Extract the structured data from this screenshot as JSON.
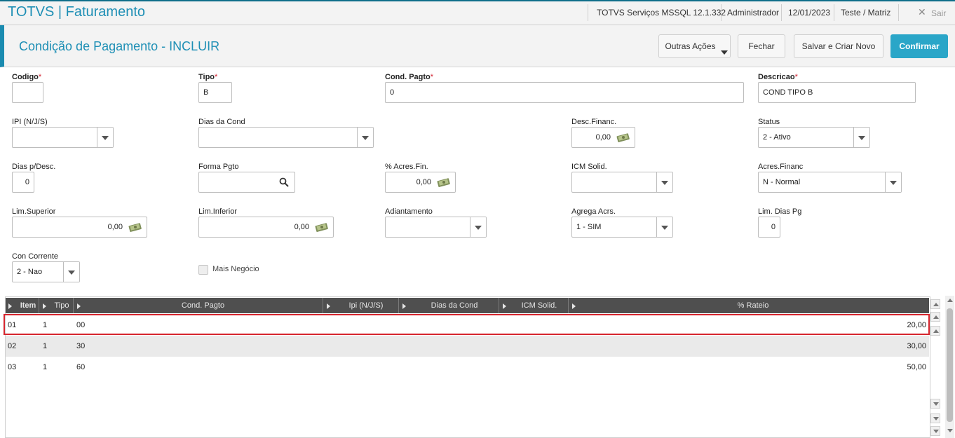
{
  "app": {
    "title": "TOTVS | Faturamento"
  },
  "topbar": {
    "server": "TOTVS Serviços MSSQL 12.1.332",
    "user": "Administrador",
    "date": "12/01/2023",
    "branch": "Teste / Matriz",
    "exit_label": "Sair"
  },
  "header": {
    "title": "Condição de Pagamento - INCLUIR",
    "buttons": {
      "outras_acoes": "Outras Ações",
      "fechar": "Fechar",
      "salvar_novo": "Salvar e Criar Novo",
      "confirmar": "Confirmar"
    }
  },
  "form": {
    "codigo": {
      "label": "Codigo",
      "value": ""
    },
    "tipo": {
      "label": "Tipo",
      "value": "B"
    },
    "cond_pagto": {
      "label": "Cond. Pagto",
      "value": "0"
    },
    "descricao": {
      "label": "Descricao",
      "value": "COND TIPO B"
    },
    "ipi": {
      "label": "IPI (N/J/S)",
      "value": ""
    },
    "dias_cond": {
      "label": "Dias da Cond",
      "value": ""
    },
    "desc_financ": {
      "label": "Desc.Financ.",
      "value": "0,00"
    },
    "status": {
      "label": "Status",
      "value": "2 - Ativo"
    },
    "dias_desc": {
      "label": "Dias p/Desc.",
      "value": "0"
    },
    "forma_pgto": {
      "label": "Forma Pgto",
      "value": ""
    },
    "acres_fin": {
      "label": "% Acres.Fin.",
      "value": "0,00"
    },
    "icm_solid": {
      "label": "ICM Solid.",
      "value": ""
    },
    "acres_financ": {
      "label": "Acres.Financ",
      "value": "N - Normal"
    },
    "lim_superior": {
      "label": "Lim.Superior",
      "value": "0,00"
    },
    "lim_inferior": {
      "label": "Lim.Inferior",
      "value": "0,00"
    },
    "adiantamento": {
      "label": "Adiantamento",
      "value": ""
    },
    "agrega_acrs": {
      "label": "Agrega Acrs.",
      "value": "1 - SIM"
    },
    "lim_dias_pg": {
      "label": "Lim. Dias Pg",
      "value": "0"
    },
    "con_corrente": {
      "label": "Con Corrente",
      "value": "2 - Nao"
    },
    "mais_negocio": {
      "label": "Mais Negócio",
      "checked": false
    }
  },
  "grid": {
    "columns": [
      "Item",
      "Tipo",
      "Cond. Pagto",
      "Ipi (N/J/S)",
      "Dias da Cond",
      "ICM Solid.",
      "% Rateio"
    ],
    "rows": [
      {
        "item": "01",
        "tipo": "1",
        "cond": "00",
        "rateio": "20,00",
        "selected": true
      },
      {
        "item": "02",
        "tipo": "1",
        "cond": "30",
        "rateio": "30,00"
      },
      {
        "item": "03",
        "tipo": "1",
        "cond": "60",
        "rateio": "50,00"
      }
    ]
  },
  "colors": {
    "accent": "#1e8fb5",
    "primary_button": "#2aa6c8",
    "required": "#d2202f",
    "selection": "#d6262e",
    "grid_header": "#4f4f4f"
  },
  "icons": [
    "close-icon",
    "dropdown-arrow-icon",
    "money-icon",
    "search-icon",
    "sort-arrow-icon",
    "scroll-up-icon",
    "scroll-down-icon"
  ]
}
